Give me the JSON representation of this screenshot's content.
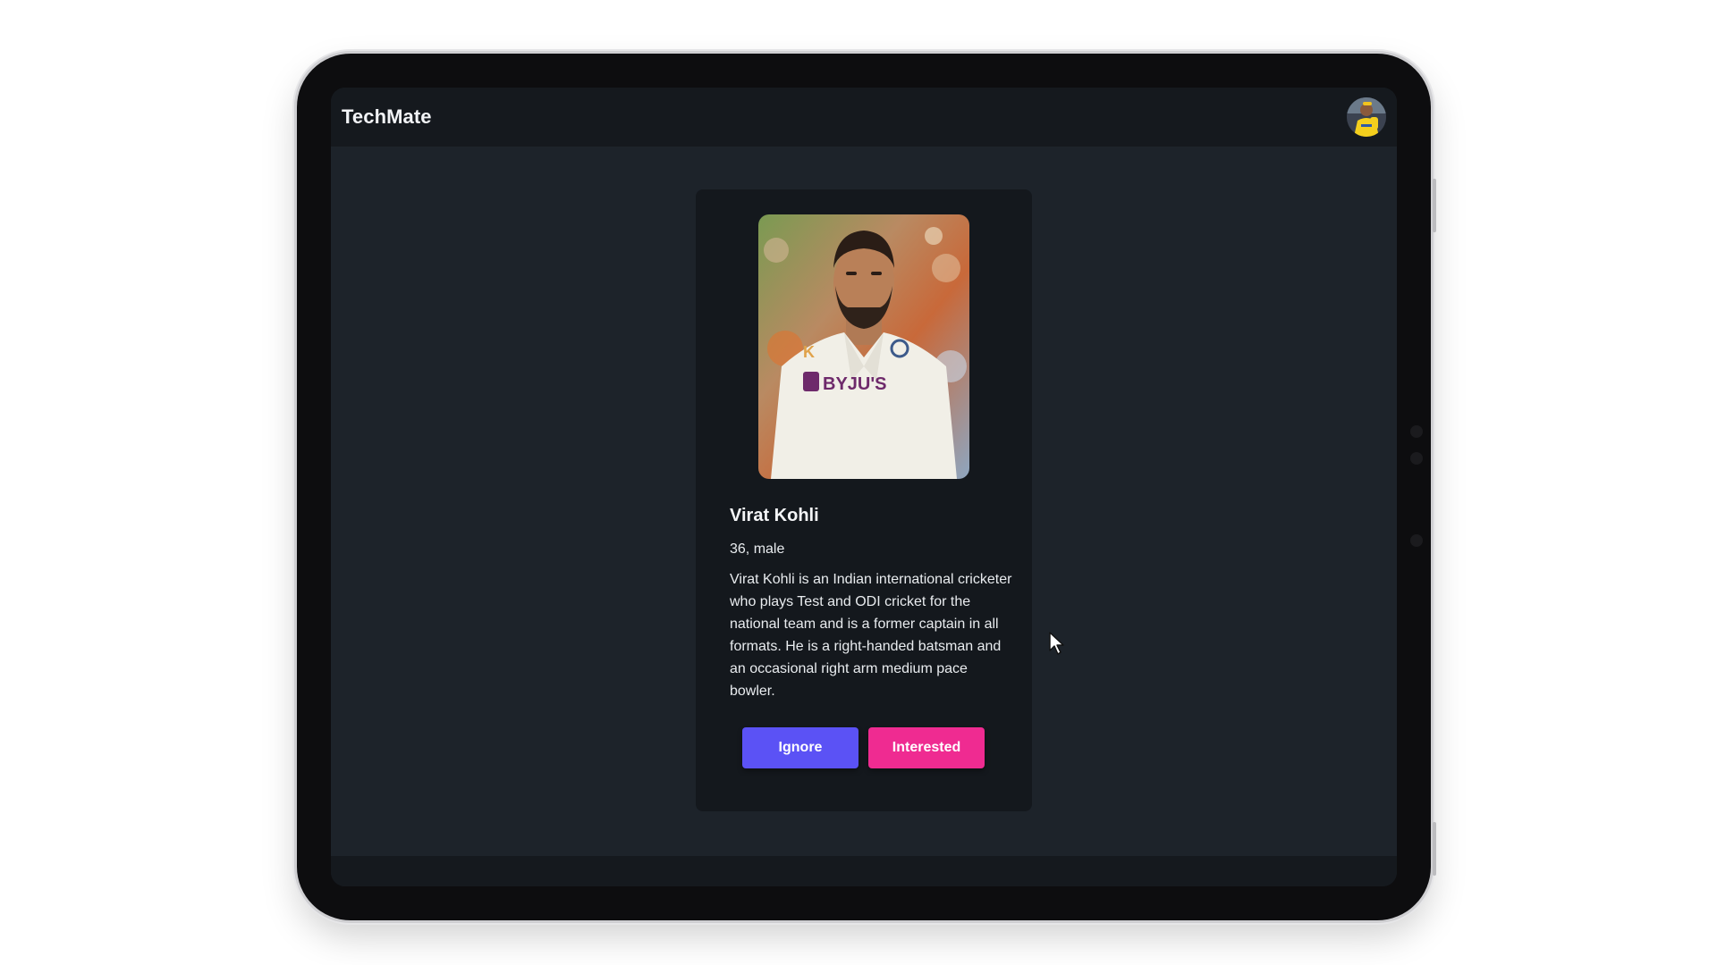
{
  "app": {
    "brand": "TechMate"
  },
  "profile": {
    "name": "Virat Kohli",
    "age_gender": "36, male",
    "about": "Virat Kohli is an Indian international cricketer who plays Test and ODI cricket for the national team and is a former captain in all formats. He is a right-handed batsman and an occasional right arm medium pace bowler.",
    "photo_jersey_text": "BYJU'S"
  },
  "actions": {
    "ignore_label": "Ignore",
    "interested_label": "Interested"
  },
  "colors": {
    "page_bg": "#1d232a",
    "navbar_bg": "#15191e",
    "card_bg": "#14181d",
    "ignore_button": "#5b52f5",
    "interested_button": "#ef2b91"
  },
  "icons": {
    "avatar": "user-avatar-icon",
    "cursor": "mouse-pointer-icon"
  }
}
